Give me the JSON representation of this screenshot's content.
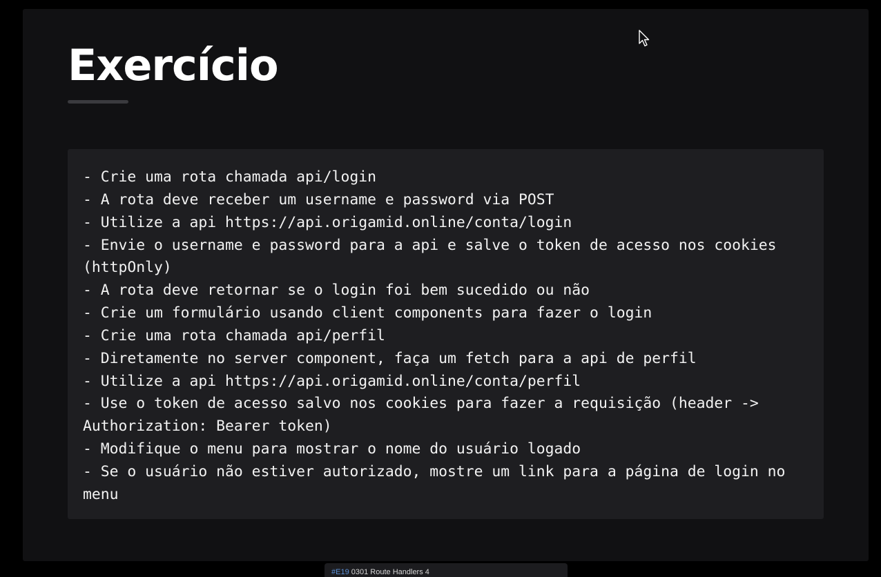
{
  "slide": {
    "title": "Exercício",
    "lines": [
      "- Crie uma rota chamada api/login",
      "- A rota deve receber um username e password via POST",
      "- Utilize a api https://api.origamid.online/conta/login",
      "- Envie o username e password para a api e salve o token de acesso nos cookies",
      "(httpOnly)",
      "- A rota deve retornar se o login foi bem sucedido ou não",
      "- Crie um formulário usando client components para fazer o login",
      "- Crie uma rota chamada api/perfil",
      "- Diretamente no server component, faça um fetch para a api de perfil",
      "- Utilize a api https://api.origamid.online/conta/perfil",
      "- Use o token de acesso salvo nos cookies para fazer a requisição (header ->",
      "Authorization: Bearer token)",
      "- Modifique o menu para mostrar o nome do usuário logado",
      "- Se o usuário não estiver autorizado, mostre um link para a página de login no",
      "menu"
    ]
  },
  "bottom_tab": {
    "tag": "#E19",
    "label": "0301 Route Handlers 4"
  },
  "icons": {
    "cursor": "mouse-pointer-icon"
  },
  "colors": {
    "background": "#000000",
    "slide": "#111113",
    "code_box": "#1e1e21",
    "text": "#f2f2f2",
    "tag": "#5b8fd6"
  }
}
